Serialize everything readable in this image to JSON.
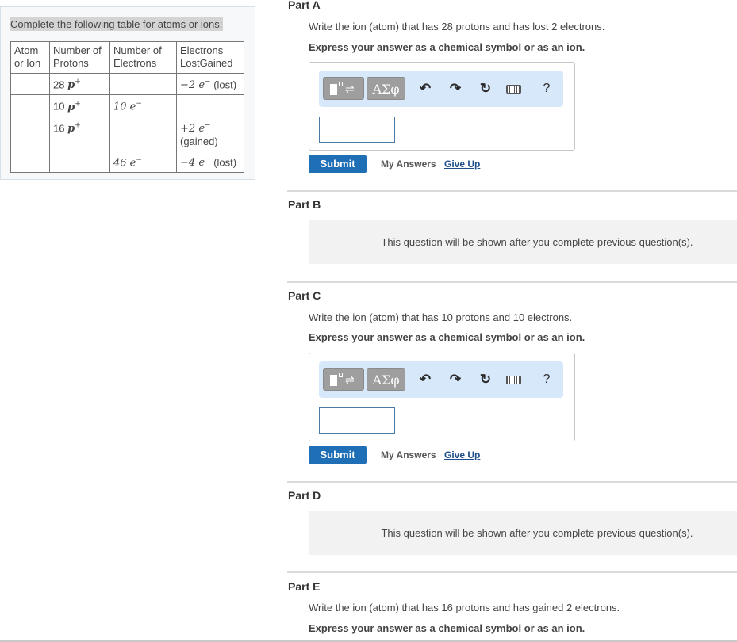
{
  "left": {
    "prompt": "Complete the following table for atoms or ions:",
    "table": {
      "headers": [
        [
          "Atom",
          "or Ion"
        ],
        [
          "Number of",
          "Protons"
        ],
        [
          "Number of",
          "Electrons"
        ],
        [
          "Electrons",
          "LostGained"
        ]
      ],
      "rows": [
        {
          "atom": "",
          "protons_num": "28",
          "protons_sym": "p",
          "protons_sup": "+",
          "electrons": "",
          "change_num": "−2",
          "change_sym": "e",
          "change_sup": "−",
          "change_note": "(lost)"
        },
        {
          "atom": "",
          "protons_num": "10",
          "protons_sym": "p",
          "protons_sup": "+",
          "electrons": "10 e",
          "electrons_sup": "−",
          "change_num": "",
          "change_note": ""
        },
        {
          "atom": "",
          "protons_num": "16",
          "protons_sym": "p",
          "protons_sup": "+",
          "electrons": "",
          "change_num": "+2",
          "change_sym": "e",
          "change_sup": "−",
          "change_note": "(gained)"
        },
        {
          "atom": "",
          "protons_num": "",
          "electrons": "46 e",
          "electrons_sup": "−",
          "change_num": "−4",
          "change_sym": "e",
          "change_sup": "−",
          "change_note": "(lost)"
        }
      ]
    }
  },
  "parts": {
    "a": {
      "title": "Part A",
      "question": "Write the ion (atom) that has 28 protons and has lost 2 electrons.",
      "instruction": "Express your answer as a chemical symbol or as an ion.",
      "input_value": ""
    },
    "b": {
      "title": "Part B",
      "locked_text": "This question will be shown after you complete previous question(s)."
    },
    "c": {
      "title": "Part C",
      "question": "Write the ion (atom) that has 10 protons and 10 electrons.",
      "instruction": "Express your answer as a chemical symbol or as an ion.",
      "input_value": ""
    },
    "d": {
      "title": "Part D",
      "locked_text": "This question will be shown after you complete previous question(s)."
    },
    "e": {
      "title": "Part E",
      "question": "Write the ion (atom) that has 16 protons and has gained 2 electrons.",
      "instruction": "Express your answer as a chemical symbol or as an ion."
    }
  },
  "toolbar": {
    "greek_label": "ΑΣφ",
    "help_label": "?",
    "icons": [
      "templates-icon",
      "greek-letters-icon",
      "undo-icon",
      "redo-icon",
      "reset-icon",
      "keyboard-icon",
      "help-icon"
    ]
  },
  "actions": {
    "submit_label": "Submit",
    "my_answers_label": "My Answers",
    "give_up_label": "Give Up"
  },
  "colors": {
    "submit_bg": "#1f6fb6",
    "toolbar_bg": "#d6e8fa",
    "link": "#1f4f8a"
  }
}
